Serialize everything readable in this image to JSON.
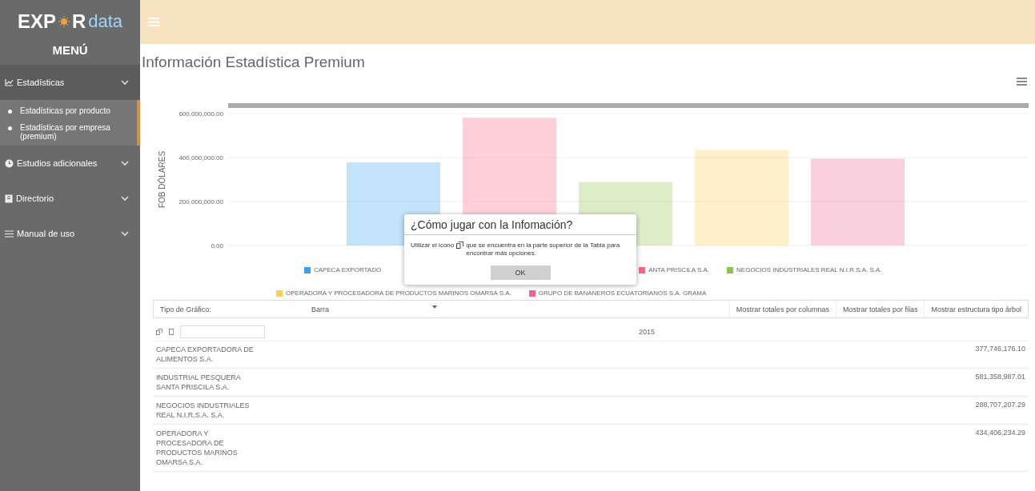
{
  "logo": {
    "part_a": "EXP",
    "part_b": "R",
    "part_c": "data"
  },
  "menu_title": "MENÚ",
  "sidebar": {
    "items": [
      {
        "label": "Estadísticas",
        "expanded": true,
        "children": [
          {
            "label": "Estadísticas por producto"
          },
          {
            "label": "Estadísticas por empresa (premium)"
          }
        ]
      },
      {
        "label": "Estudios adicionales",
        "expanded": false
      },
      {
        "label": "Directorio",
        "expanded": false
      },
      {
        "label": "Manual de uso",
        "expanded": false
      }
    ]
  },
  "page_title": "Información Estadística Premium",
  "chart": {
    "chart_data": {
      "type": "bar",
      "ylabel": "FOB DÓLARES",
      "ylim": [
        0,
        600000000
      ],
      "yticks": [
        {
          "value": 0,
          "label": "0.00"
        },
        {
          "value": 200000000,
          "label": "200,000,000.00"
        },
        {
          "value": 400000000,
          "label": "400,000,000.00"
        },
        {
          "value": 600000000,
          "label": "600,000,000.00"
        }
      ],
      "series": [
        {
          "name": "CAPECA EXPORTADO",
          "color": "#36a2eb",
          "values": [
            378000000
          ]
        },
        {
          "name": "ANTA PRISCILA S.A.",
          "color": "#ff6384",
          "values": [
            581000000
          ]
        },
        {
          "name": "NEGOCIOS INDUSTRIALES REAL N.I.R.S.A. S.A.",
          "color": "#8bc34a",
          "values": [
            289000000
          ]
        },
        {
          "name": "OPERADORA Y PROCESADORA DE PRODUCTOS MARINOS OMARSA S.A.",
          "color": "#ffce56",
          "values": [
            434000000
          ]
        },
        {
          "name": "GRUPO DE BANANEROS ECUATORIANOS S.A. GRAMA",
          "color": "#f06292",
          "values": [
            395000000
          ]
        }
      ]
    }
  },
  "controls": {
    "chart_type_label": "Tipo de Gráfico:",
    "chart_type": "Barra",
    "buttons": [
      "Mostrar totales por columnas",
      "Mostrar totales por filas",
      "Mostrar estructura tipo árbol"
    ]
  },
  "table": {
    "column_header": "2015",
    "rows": [
      {
        "name": "CAPECA EXPORTADORA DE ALIMENTOS S.A.",
        "value": "377,746,176.10"
      },
      {
        "name": "INDUSTRIAL PESQUERA SANTA PRISCILA S.A.",
        "value": "581,358,987.01"
      },
      {
        "name": "NEGOCIOS INDUSTRIALES REAL N.I.R.S.A. S.A.",
        "value": "288,707,207.29"
      },
      {
        "name": "OPERADORA Y PROCESADORA DE PRODUCTOS MARINOS OMARSA S.A.",
        "value": "434,406,234.29"
      }
    ]
  },
  "dialog": {
    "title": "¿Cómo jugar con la Infomación?",
    "text_before": "Utilizar el icono",
    "text_after": "que se encuentra en la parte superior de la Tabla para encontrar más opciones.",
    "button": "OK"
  }
}
